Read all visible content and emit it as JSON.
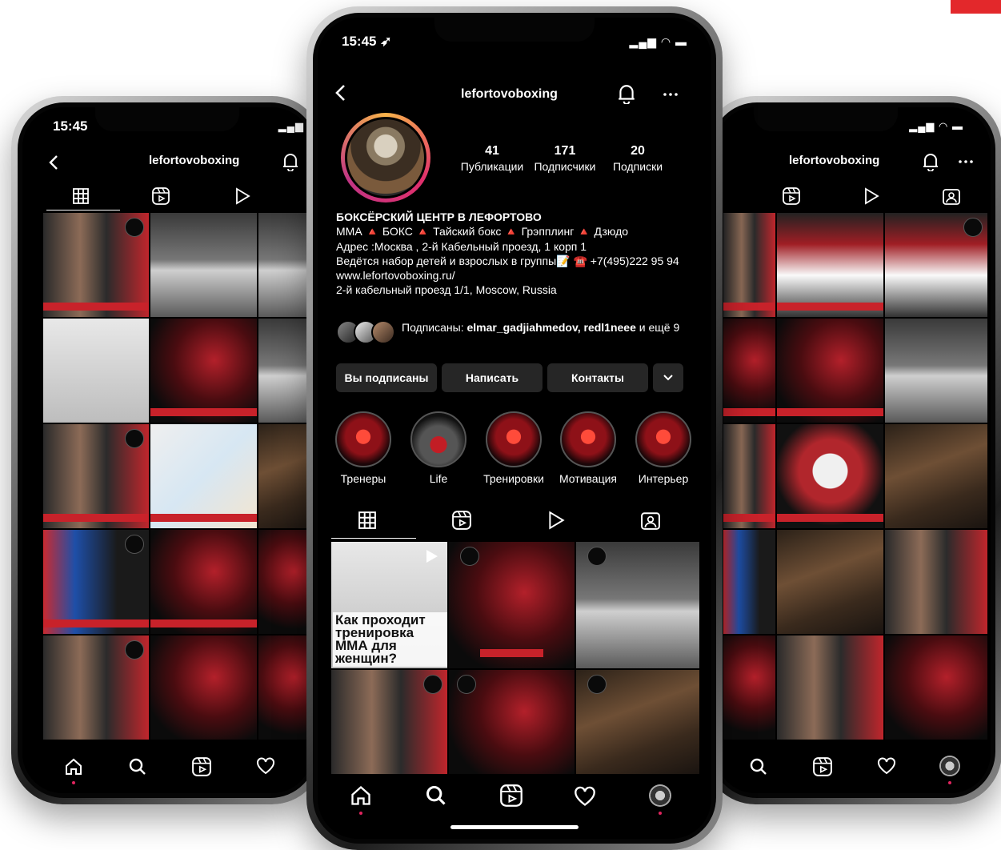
{
  "accent": "#e3282b",
  "status": {
    "time": "15:45",
    "location_glyph": "➶"
  },
  "profile": {
    "username": "lefortovoboxing",
    "stats": [
      {
        "value": "41",
        "label": "Публикации"
      },
      {
        "value": "171",
        "label": "Подписчики"
      },
      {
        "value": "20",
        "label": "Подписки"
      }
    ],
    "bio": {
      "name": "БОКСЁРСКИЙ ЦЕНТР В ЛЕФОРТОВО",
      "line1": "ММА 🔺 БОКС 🔺 Тайский бокс 🔺 Грэпплинг 🔺 Дзюдо",
      "line2": "Адрес :Москва , 2-й Кабельный проезд, 1 корп 1",
      "line3": "Ведётся набор детей и взрослых в группы📝 ☎️ +7(495)222 95 94",
      "link": "www.lefortovoboxing.ru/",
      "location": "2-й кабельный проезд 1/1, Moscow, Russia"
    },
    "followed_by_prefix": "Подписаны:",
    "followed_by_names": "elmar_gadjiahmedov, redl1neee",
    "followed_by_suffix": "и ещё 9",
    "buttons": {
      "following": "Вы подписаны",
      "message": "Написать",
      "contacts": "Контакты"
    },
    "highlights": [
      "Тренеры",
      "Life",
      "Тренировки",
      "Мотивация",
      "Интерьер"
    ],
    "post_caption": "Как проходит тренировка ММА для женщин?"
  },
  "icons": {
    "back": "back-arrow-icon",
    "bell": "bell-icon",
    "more": "more-icon",
    "grid": "grid-icon",
    "reels": "reels-icon",
    "play": "play-icon",
    "tagged": "tagged-icon",
    "home": "home-icon",
    "search": "search-icon",
    "heart": "heart-icon",
    "chevron": "chevron-down-icon"
  }
}
